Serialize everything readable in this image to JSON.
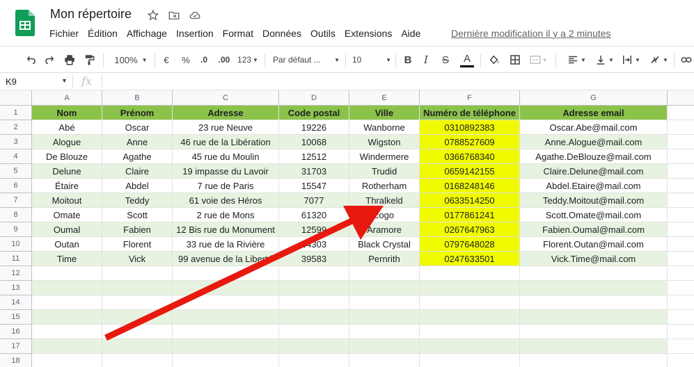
{
  "app": {
    "title": "Mon répertoire",
    "last_edit": "Dernière modification il y a 2 minutes",
    "logo_icon": "google-sheets-logo",
    "accent": "#0f9d58"
  },
  "menu": [
    "Fichier",
    "Édition",
    "Affichage",
    "Insertion",
    "Format",
    "Données",
    "Outils",
    "Extensions",
    "Aide"
  ],
  "toolbar": {
    "zoom": "100%",
    "currency": "€",
    "percent": "%",
    "dec_decrease": ".0",
    "dec_increase": ".00",
    "number_format": "123",
    "font": "Par défaut ...",
    "font_size": "10",
    "bold": "B",
    "italic": "I",
    "strike": "S",
    "text_color": "A"
  },
  "formula_bar": {
    "cell_ref": "K9",
    "fx": "fx"
  },
  "columns": [
    "A",
    "B",
    "C",
    "D",
    "E",
    "F",
    "G"
  ],
  "rows": [
    "1",
    "2",
    "3",
    "4",
    "5",
    "6",
    "7",
    "8",
    "9",
    "10",
    "11",
    "12",
    "13",
    "14",
    "15",
    "16",
    "17",
    "18"
  ],
  "table": {
    "headers": [
      "Nom",
      "Prénom",
      "Adresse",
      "Code postal",
      "Ville",
      "Numéro de téléphone",
      "Adresse email"
    ],
    "records": [
      [
        "Abé",
        "Oscar",
        "23 rue Neuve",
        "19226",
        "Wanborne",
        "0310892383",
        "Oscar.Abe@mail.com"
      ],
      [
        "Alogue",
        "Anne",
        "46 rue de la Libération",
        "10068",
        "Wigston",
        "0788527609",
        "Anne.Alogue@mail.com"
      ],
      [
        "De Blouze",
        "Agathe",
        "45 rue du Moulin",
        "12512",
        "Windermere",
        "0366768340",
        "Agathe.DeBlouze@mail.com"
      ],
      [
        "Delune",
        "Claire",
        "19 impasse du Lavoir",
        "31703",
        "Trudid",
        "0659142155",
        "Claire.Delune@mail.com"
      ],
      [
        "Étaire",
        "Abdel",
        "7 rue de Paris",
        "15547",
        "Rotherham",
        "0168248146",
        "Abdel.Etaire@mail.com"
      ],
      [
        "Moitout",
        "Teddy",
        "61 voie des Héros",
        "7077",
        "Thralkeld",
        "0633514250",
        "Teddy.Moitout@mail.com"
      ],
      [
        "Omate",
        "Scott",
        "2 rue de Mons",
        "61320",
        "cogo",
        "0177861241",
        "Scott.Omate@mail.com"
      ],
      [
        "Oumal",
        "Fabien",
        "12 Bis rue du Monument",
        "12599",
        "Aramore",
        "0267647963",
        "Fabien.Oumal@mail.com"
      ],
      [
        "Outan",
        "Florent",
        "33 rue de la Rivière",
        "64303",
        "Black Crystal",
        "0797648028",
        "Florent.Outan@mail.com"
      ],
      [
        "Time",
        "Vick",
        "99 avenue de la Liberté",
        "39583",
        "Pernrith",
        "0247633501",
        "Vick.Time@mail.com"
      ]
    ]
  },
  "colors": {
    "header_fill": "#8bc34a",
    "band_fill": "#e7f3e0",
    "phone_fill": "#f0fa00",
    "arrow": "#e8190e"
  }
}
